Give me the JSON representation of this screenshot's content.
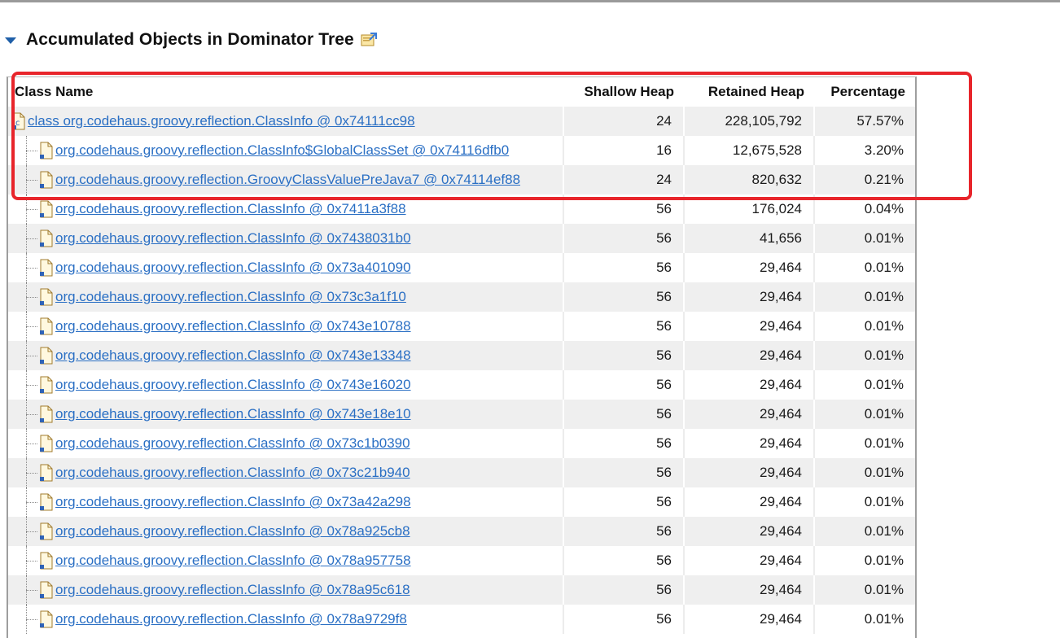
{
  "section": {
    "title": "Accumulated Objects in Dominator Tree",
    "icon": "export-icon"
  },
  "table": {
    "columns": [
      "Class Name",
      "Shallow Heap",
      "Retained Heap",
      "Percentage"
    ],
    "rows": [
      {
        "name": "class org.codehaus.groovy.reflection.ClassInfo @ 0x74111cc98",
        "shallow": "24",
        "retained": "228,105,792",
        "percentage": "57.57%",
        "icon": "class-icon",
        "level": 0
      },
      {
        "name": "org.codehaus.groovy.reflection.ClassInfo$GlobalClassSet @ 0x74116dfb0",
        "shallow": "16",
        "retained": "12,675,528",
        "percentage": "3.20%",
        "icon": "object-icon",
        "level": 1
      },
      {
        "name": "org.codehaus.groovy.reflection.GroovyClassValuePreJava7 @ 0x74114ef88",
        "shallow": "24",
        "retained": "820,632",
        "percentage": "0.21%",
        "icon": "object-icon",
        "level": 1
      },
      {
        "name": "org.codehaus.groovy.reflection.ClassInfo @ 0x7411a3f88",
        "shallow": "56",
        "retained": "176,024",
        "percentage": "0.04%",
        "icon": "object-icon",
        "level": 1
      },
      {
        "name": "org.codehaus.groovy.reflection.ClassInfo @ 0x7438031b0",
        "shallow": "56",
        "retained": "41,656",
        "percentage": "0.01%",
        "icon": "object-icon",
        "level": 1
      },
      {
        "name": "org.codehaus.groovy.reflection.ClassInfo @ 0x73a401090",
        "shallow": "56",
        "retained": "29,464",
        "percentage": "0.01%",
        "icon": "object-icon",
        "level": 1
      },
      {
        "name": "org.codehaus.groovy.reflection.ClassInfo @ 0x73c3a1f10",
        "shallow": "56",
        "retained": "29,464",
        "percentage": "0.01%",
        "icon": "object-icon",
        "level": 1
      },
      {
        "name": "org.codehaus.groovy.reflection.ClassInfo @ 0x743e10788",
        "shallow": "56",
        "retained": "29,464",
        "percentage": "0.01%",
        "icon": "object-icon",
        "level": 1
      },
      {
        "name": "org.codehaus.groovy.reflection.ClassInfo @ 0x743e13348",
        "shallow": "56",
        "retained": "29,464",
        "percentage": "0.01%",
        "icon": "object-icon",
        "level": 1
      },
      {
        "name": "org.codehaus.groovy.reflection.ClassInfo @ 0x743e16020",
        "shallow": "56",
        "retained": "29,464",
        "percentage": "0.01%",
        "icon": "object-icon",
        "level": 1
      },
      {
        "name": "org.codehaus.groovy.reflection.ClassInfo @ 0x743e18e10",
        "shallow": "56",
        "retained": "29,464",
        "percentage": "0.01%",
        "icon": "object-icon",
        "level": 1
      },
      {
        "name": "org.codehaus.groovy.reflection.ClassInfo @ 0x73c1b0390",
        "shallow": "56",
        "retained": "29,464",
        "percentage": "0.01%",
        "icon": "object-icon",
        "level": 1
      },
      {
        "name": "org.codehaus.groovy.reflection.ClassInfo @ 0x73c21b940",
        "shallow": "56",
        "retained": "29,464",
        "percentage": "0.01%",
        "icon": "object-icon",
        "level": 1
      },
      {
        "name": "org.codehaus.groovy.reflection.ClassInfo @ 0x73a42a298",
        "shallow": "56",
        "retained": "29,464",
        "percentage": "0.01%",
        "icon": "object-icon",
        "level": 1
      },
      {
        "name": "org.codehaus.groovy.reflection.ClassInfo @ 0x78a925cb8",
        "shallow": "56",
        "retained": "29,464",
        "percentage": "0.01%",
        "icon": "object-icon",
        "level": 1
      },
      {
        "name": "org.codehaus.groovy.reflection.ClassInfo @ 0x78a957758",
        "shallow": "56",
        "retained": "29,464",
        "percentage": "0.01%",
        "icon": "object-icon",
        "level": 1
      },
      {
        "name": "org.codehaus.groovy.reflection.ClassInfo @ 0x78a95c618",
        "shallow": "56",
        "retained": "29,464",
        "percentage": "0.01%",
        "icon": "object-icon",
        "level": 1
      },
      {
        "name": "org.codehaus.groovy.reflection.ClassInfo @ 0x78a9729f8",
        "shallow": "56",
        "retained": "29,464",
        "percentage": "0.01%",
        "icon": "object-icon",
        "level": 1
      }
    ]
  },
  "colors": {
    "link": "#2a6fc4",
    "highlight": "#e8252b",
    "row_alt": "#efefef"
  }
}
